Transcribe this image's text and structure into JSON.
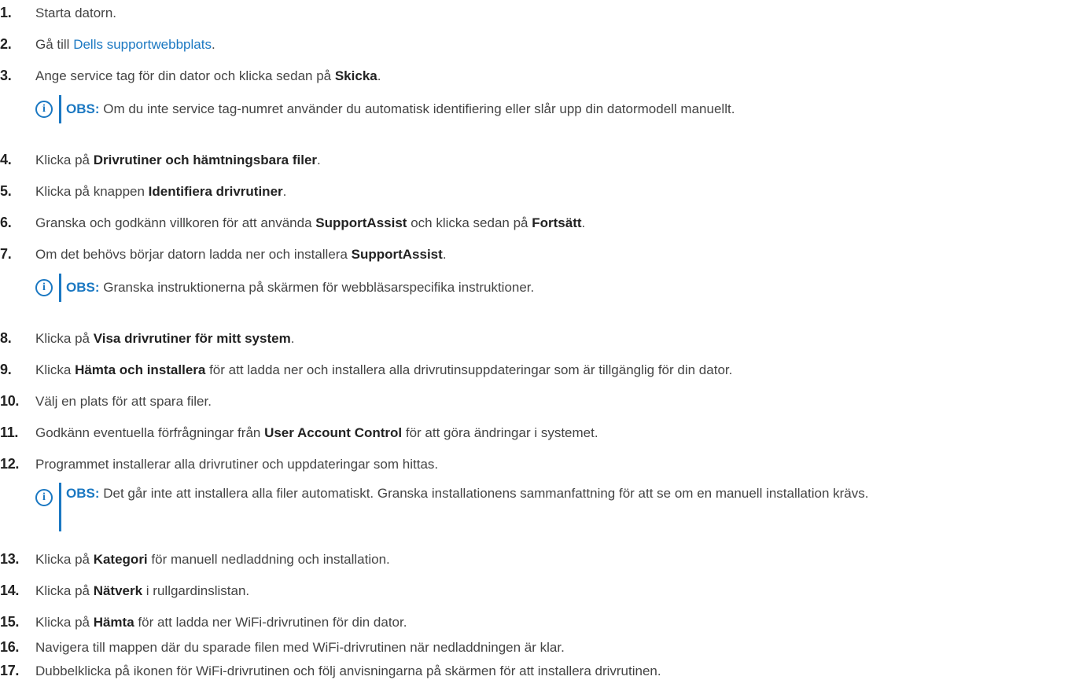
{
  "steps": [
    {
      "n": "1.",
      "parts": [
        "Starta datorn."
      ]
    },
    {
      "n": "2.",
      "parts": [
        "Gå till ",
        "Dells supportwebbplats",
        "."
      ]
    },
    {
      "n": "3.",
      "parts": [
        "Ange service tag för din dator och klicka sedan på ",
        "Skicka",
        "."
      ]
    },
    {
      "n": "4.",
      "parts": [
        "Klicka på ",
        "Drivrutiner och hämtningsbara filer",
        "."
      ]
    },
    {
      "n": "5.",
      "parts": [
        "Klicka på knappen ",
        "Identifiera drivrutiner",
        "."
      ]
    },
    {
      "n": "6.",
      "parts": [
        "Granska och godkänn villkoren för att använda ",
        "SupportAssist",
        " och klicka sedan på ",
        "Fortsätt",
        "."
      ]
    },
    {
      "n": "7.",
      "parts": [
        "Om det behövs börjar datorn ladda ner och installera ",
        "SupportAssist",
        "."
      ]
    },
    {
      "n": "8.",
      "parts": [
        "Klicka på ",
        "Visa drivrutiner för mitt system",
        "."
      ]
    },
    {
      "n": "9.",
      "parts": [
        "Klicka ",
        "Hämta och installera",
        " för att ladda ner och installera alla drivrutinsuppdateringar som är tillgänglig för din dator."
      ]
    },
    {
      "n": "10.",
      "parts": [
        "Välj en plats för att spara filer."
      ]
    },
    {
      "n": "11.",
      "parts": [
        "Godkänn eventuella förfrågningar från ",
        "User Account Control",
        " för att göra ändringar i systemet."
      ]
    },
    {
      "n": "12.",
      "parts": [
        "Programmet installerar alla drivrutiner och uppdateringar som hittas."
      ]
    },
    {
      "n": "13.",
      "parts": [
        "Klicka på ",
        "Kategori",
        " för manuell nedladdning och installation."
      ]
    },
    {
      "n": "14.",
      "parts": [
        "Klicka på ",
        "Nätverk",
        " i rullgardinslistan."
      ]
    },
    {
      "n": "15.",
      "parts": [
        "Klicka på ",
        "Hämta",
        " för att ladda ner WiFi-drivrutinen för din dator."
      ]
    },
    {
      "n": "16.",
      "parts": [
        "Navigera till mappen där du sparade filen med WiFi-drivrutinen när nedladdningen är klar."
      ]
    },
    {
      "n": "17.",
      "parts": [
        "Dubbelklicka på ikonen för WiFi-drivrutinen och följ anvisningarna på skärmen för att installera drivrutinen."
      ]
    }
  ],
  "notes": [
    {
      "label": "OBS:",
      "text": " Om du inte service tag-numret använder du automatisk identifiering eller slår upp din datormodell manuellt.",
      "icon_glyph": "i",
      "icon": "info-icon"
    },
    {
      "label": "OBS:",
      "text": " Granska instruktionerna på skärmen för webbläsarspecifika instruktioner.",
      "icon_glyph": "i",
      "icon": "info-icon"
    },
    {
      "label": "OBS:",
      "text": " Det går inte att installera alla filer automatiskt. Granska installationens sammanfattning för att se om en manuell installation krävs.",
      "icon_glyph": "i",
      "icon": "info-icon"
    }
  ],
  "colors": {
    "link": "#1b78c2",
    "text": "#444444",
    "strong": "#222222"
  }
}
